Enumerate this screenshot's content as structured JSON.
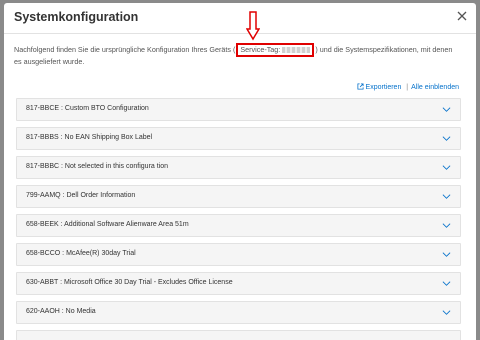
{
  "dialog": {
    "title": "Systemkonfiguration",
    "intro_before": "Nachfolgend finden Sie die ursprüngliche Konfiguration Ihres Geräts (",
    "service_tag_label": "Service-Tag:",
    "intro_after": ") und die Systemspezifikationen, mit denen es ausgeliefert wurde.",
    "export_label": "Exportieren",
    "expand_all_label": "Alle einblenden"
  },
  "components": [
    {
      "label": "817-BBCE : Custom BTO Configuration"
    },
    {
      "label": "817-BBBS : No EAN Shipping Box Label"
    },
    {
      "label": "817-BBBC : Not selected in this configura tion"
    },
    {
      "label": "799-AAMQ : Dell Order Information"
    },
    {
      "label": "658-BEEK : Additional Software Alienware Area 51m"
    },
    {
      "label": "658-BCCO : McAfee(R) 30day Trial"
    },
    {
      "label": "630-ABBT : Microsoft Office 30 Day Trial - Excludes Office License"
    },
    {
      "label": "620-AAOH : No Media"
    },
    {
      "label": ""
    }
  ],
  "colors": {
    "accent": "#0672cb",
    "highlight": "#e00000"
  }
}
